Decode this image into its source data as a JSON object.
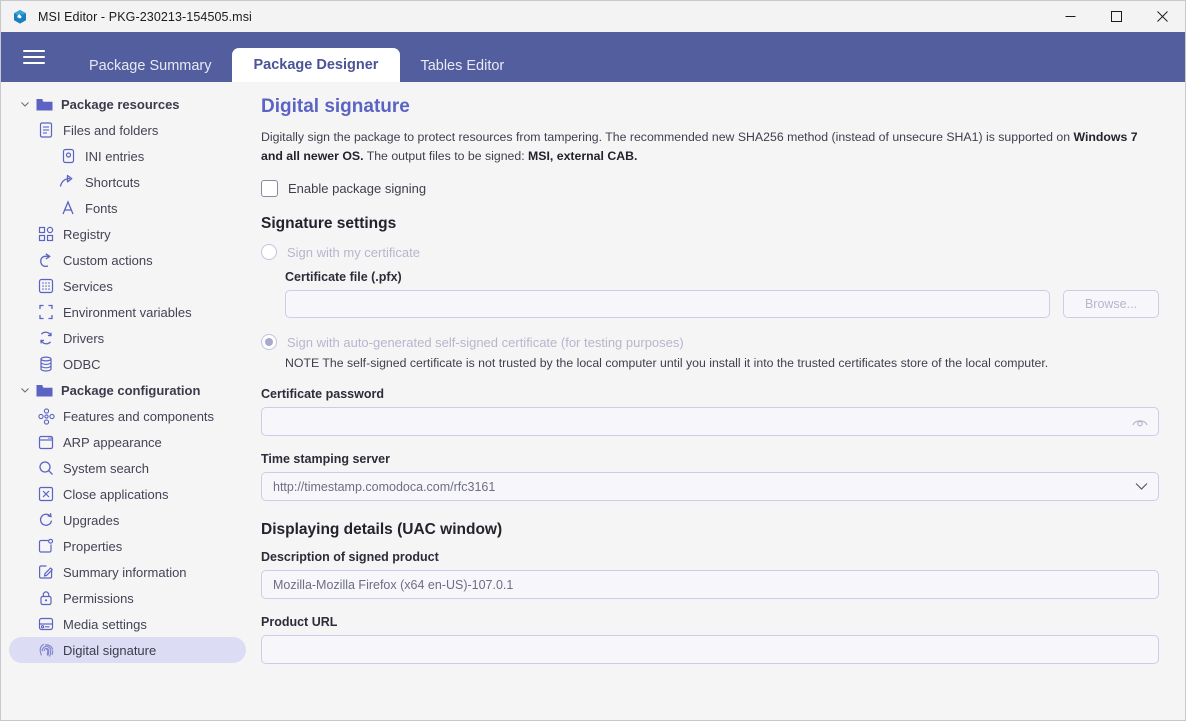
{
  "window": {
    "title": "MSI Editor - PKG-230213-154505.msi",
    "app_icon": "msi-editor-logo-icon",
    "controls": {
      "minimize": "─",
      "maximize": "□",
      "close": "✕"
    }
  },
  "header": {
    "menu_icon": "hamburger-menu-icon",
    "accent_color": "#525e9e",
    "tabs": [
      {
        "label": "Package Summary",
        "active": false
      },
      {
        "label": "Package Designer",
        "active": true
      },
      {
        "label": "Tables Editor",
        "active": false
      }
    ]
  },
  "sidebar": {
    "items": [
      {
        "label": "Package resources",
        "icon": "folder-icon",
        "level": 0,
        "group": true,
        "expanded": true,
        "chevron": "⌄"
      },
      {
        "label": "Files and folders",
        "icon": "document-icon",
        "level": 1,
        "group": false,
        "selected": false
      },
      {
        "label": "INI entries",
        "icon": "ini-entries-icon",
        "level": 2,
        "group": false,
        "selected": false
      },
      {
        "label": "Shortcuts",
        "icon": "shortcut-arrow-icon",
        "level": 2,
        "group": false,
        "selected": false
      },
      {
        "label": "Fonts",
        "icon": "font-letter-a-icon",
        "level": 2,
        "group": false,
        "selected": false
      },
      {
        "label": "Registry",
        "icon": "registry-blocks-icon",
        "level": 1,
        "group": false,
        "selected": false
      },
      {
        "label": "Custom actions",
        "icon": "curved-arrow-icon",
        "level": 1,
        "group": false,
        "selected": false
      },
      {
        "label": "Services",
        "icon": "services-grid-icon",
        "level": 1,
        "group": false,
        "selected": false
      },
      {
        "label": "Environment variables",
        "icon": "dashed-brackets-icon",
        "level": 1,
        "group": false,
        "selected": false
      },
      {
        "label": "Drivers",
        "icon": "refresh-circle-icon",
        "level": 1,
        "group": false,
        "selected": false
      },
      {
        "label": "ODBC",
        "icon": "database-icon",
        "level": 1,
        "group": false,
        "selected": false
      },
      {
        "label": "Package configuration",
        "icon": "folder-icon",
        "level": 0,
        "group": true,
        "expanded": true,
        "chevron": "⌄"
      },
      {
        "label": "Features and components",
        "icon": "features-nodes-icon",
        "level": 1,
        "group": false,
        "selected": false
      },
      {
        "label": "ARP appearance",
        "icon": "window-icon",
        "level": 1,
        "group": false,
        "selected": false
      },
      {
        "label": "System search",
        "icon": "magnifier-icon",
        "level": 1,
        "group": false,
        "selected": false
      },
      {
        "label": "Close applications",
        "icon": "x-in-box-icon",
        "level": 1,
        "group": false,
        "selected": false
      },
      {
        "label": "Upgrades",
        "icon": "refresh-arrow-icon",
        "level": 1,
        "group": false,
        "selected": false
      },
      {
        "label": "Properties",
        "icon": "properties-square-icon",
        "level": 1,
        "group": false,
        "selected": false
      },
      {
        "label": "Summary information",
        "icon": "edit-pencil-square-icon",
        "level": 1,
        "group": false,
        "selected": false
      },
      {
        "label": "Permissions",
        "icon": "lock-icon",
        "level": 1,
        "group": false,
        "selected": false
      },
      {
        "label": "Media settings",
        "icon": "media-disk-icon",
        "level": 1,
        "group": false,
        "selected": false
      },
      {
        "label": "Digital signature",
        "icon": "fingerprint-icon",
        "level": 1,
        "group": false,
        "selected": true
      }
    ]
  },
  "main": {
    "page_title": "Digital signature",
    "description_part1": "Digitally sign the package to protect resources from tampering. The recommended new SHA256 method (instead of unsecure SHA1) is supported on ",
    "description_bold1": "Windows 7 and all newer OS.",
    "description_part2": " The output files to be signed: ",
    "description_bold2": "MSI, external CAB.",
    "enable_signing": {
      "label": "Enable package signing",
      "checked": false
    },
    "signature_settings": {
      "title": "Signature settings",
      "radio_my_cert": {
        "label": "Sign with my certificate",
        "selected": false,
        "disabled": true
      },
      "certificate_file": {
        "label": "Certificate file (.pfx)",
        "value": "",
        "placeholder": ""
      },
      "browse_button": "Browse...",
      "radio_self_signed": {
        "label": "Sign with auto-generated self-signed certificate (for testing purposes)",
        "selected": true,
        "disabled": true
      },
      "note": "NOTE The self-signed certificate is not trusted by the local computer until you install it into the trusted certificates store of the local computer.",
      "certificate_password": {
        "label": "Certificate password",
        "value": "",
        "placeholder": "",
        "reveal_icon": "eye-icon"
      },
      "timestamp_server": {
        "label": "Time stamping server",
        "value": "http://timestamp.comodoca.com/rfc3161",
        "dropdown_icon": "chevron-down-icon"
      }
    },
    "display_details": {
      "title": "Displaying details (UAC window)",
      "description_field": {
        "label": "Description of signed product",
        "value": "Mozilla-Mozilla Firefox (x64 en-US)-107.0.1"
      },
      "product_url_field": {
        "label": "Product URL",
        "value": "",
        "placeholder": ""
      }
    }
  }
}
